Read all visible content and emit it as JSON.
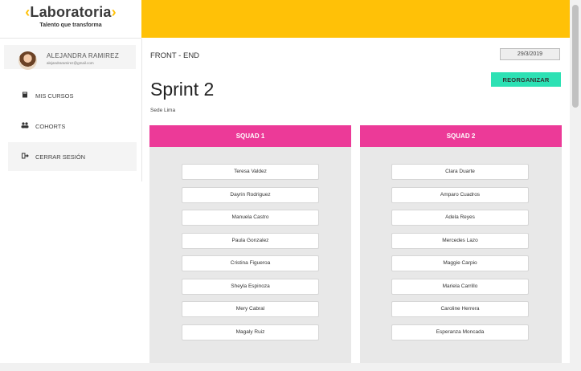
{
  "brand": {
    "name": "Laboratoria",
    "bracket_left": "‹",
    "bracket_right": "›",
    "tagline": "Talento que transforma",
    "accent": "#ffc107"
  },
  "user": {
    "name": "ALEJANDRA RAMIREZ",
    "email": "alejandraramirez@gmail.com"
  },
  "sidebar": {
    "items": [
      {
        "label": "MIS CURSOS",
        "icon": "book-icon"
      },
      {
        "label": "COHORTS",
        "icon": "users-icon"
      },
      {
        "label": "CERRAR SESIÓN",
        "icon": "sign-out-icon"
      }
    ]
  },
  "main": {
    "module_title": "FRONT - END",
    "date": "29/3/2019",
    "reorganize_label": "REORGANIZAR",
    "sprint_title": "Sprint 2",
    "sede": "Sede Lima"
  },
  "squads": [
    {
      "name": "SQUAD 1",
      "members": [
        "Teresa Valdez",
        "Dayrin Rodriguez",
        "Manuela Castro",
        "Paula Gonzalez",
        "Cristina Figueroa",
        "Sheyla Espinoza",
        "Mery Cabral",
        "Magaly Ruiz"
      ]
    },
    {
      "name": "SQUAD 2",
      "members": [
        "Clara Duarte",
        "Amparo Cuadros",
        "Adela Reyes",
        "Mercedes Lazo",
        "Maggie Carpio",
        "Mariela Carrillo",
        "Caroline Herrera",
        "Esperanza Moncada"
      ]
    }
  ],
  "colors": {
    "topbar": "#ffc107",
    "squad_header": "#ec3a98",
    "button": "#2de1b4"
  }
}
